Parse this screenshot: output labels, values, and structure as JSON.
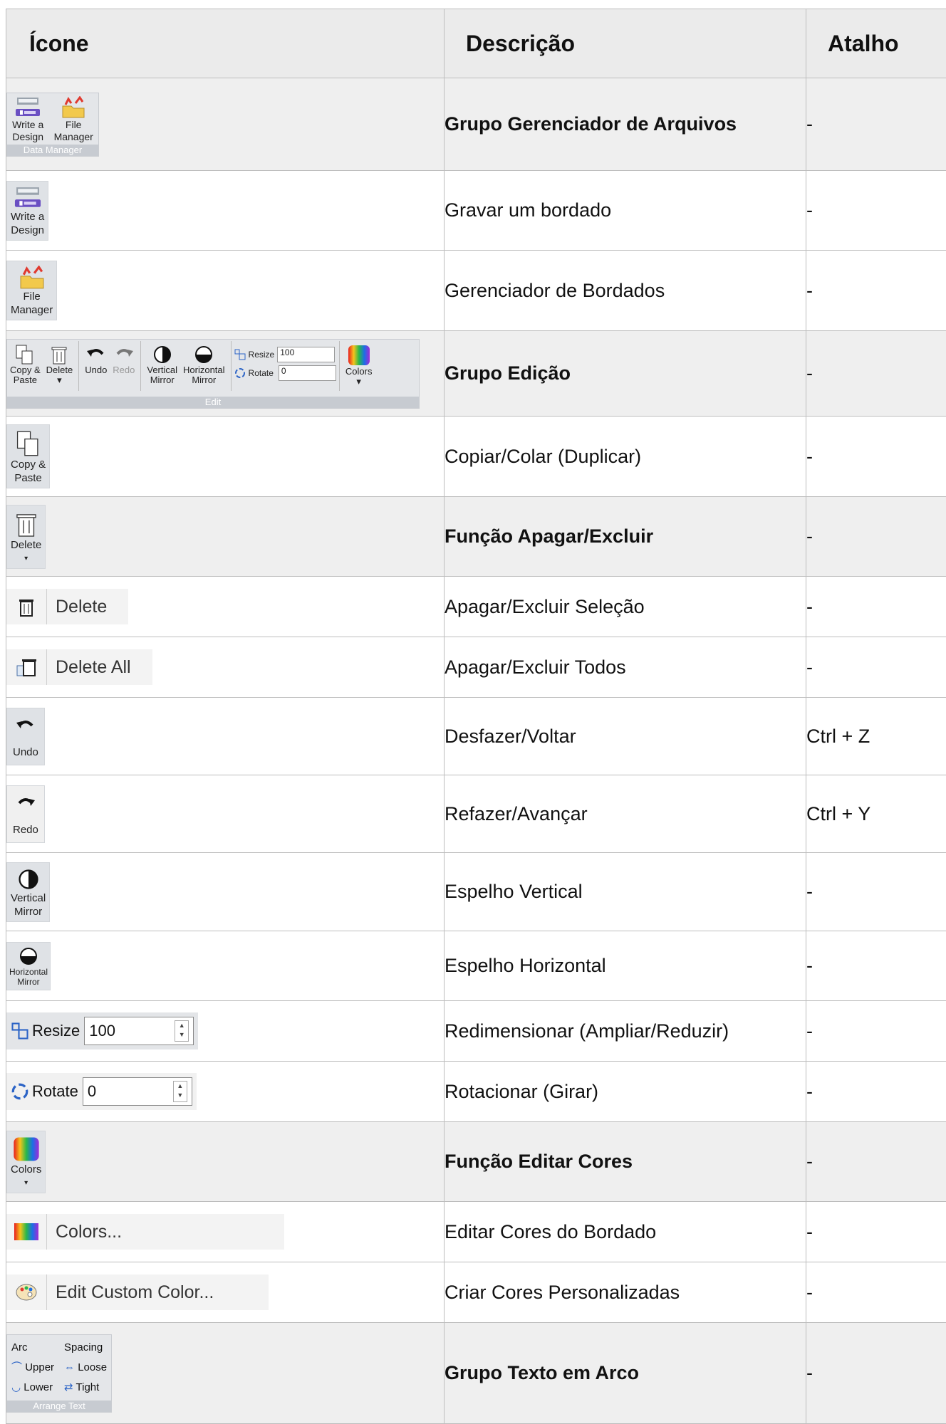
{
  "table": {
    "headers": [
      "Ícone",
      "Descrição",
      "Atalho"
    ],
    "rows": [
      {
        "desc": "Grupo Gerenciador de Arquivos",
        "shortcut": "-"
      },
      {
        "desc": "Gravar um bordado",
        "shortcut": "-"
      },
      {
        "desc": "Gerenciador de Bordados",
        "shortcut": "-"
      },
      {
        "desc": "Grupo Edição",
        "shortcut": "-"
      },
      {
        "desc": "Copiar/Colar (Duplicar)",
        "shortcut": "-"
      },
      {
        "desc": "Função Apagar/Excluir",
        "shortcut": "-"
      },
      {
        "desc": "Apagar/Excluir Seleção",
        "shortcut": "-"
      },
      {
        "desc": "Apagar/Excluir Todos",
        "shortcut": "-"
      },
      {
        "desc": "Desfazer/Voltar",
        "shortcut": "Ctrl + Z"
      },
      {
        "desc": "Refazer/Avançar",
        "shortcut": "Ctrl + Y"
      },
      {
        "desc": "Espelho Vertical",
        "shortcut": "-"
      },
      {
        "desc": "Espelho Horizontal",
        "shortcut": "-"
      },
      {
        "desc": "Redimensionar (Ampliar/Reduzir)",
        "shortcut": "-"
      },
      {
        "desc": "Rotacionar (Girar)",
        "shortcut": "-"
      },
      {
        "desc": "Função Editar Cores",
        "shortcut": "-"
      },
      {
        "desc": "Editar Cores do Bordado",
        "shortcut": "-"
      },
      {
        "desc": "Criar Cores Personalizadas",
        "shortcut": "-"
      },
      {
        "desc": "Grupo Texto em Arco",
        "shortcut": "-"
      }
    ]
  },
  "icons": {
    "write_a_design": [
      "Write a",
      "Design"
    ],
    "file_manager": [
      "File",
      "Manager"
    ],
    "data_manager_caption": "Data Manager",
    "copy_paste": [
      "Copy &",
      "Paste"
    ],
    "delete": "Delete",
    "undo": "Undo",
    "redo": "Redo",
    "vertical_mirror": [
      "Vertical",
      "Mirror"
    ],
    "horizontal_mirror": [
      "Horizontal",
      "Mirror"
    ],
    "resize_label": "Resize",
    "resize_value": "100",
    "rotate_label": "Rotate",
    "rotate_value": "0",
    "colors": "Colors",
    "edit_caption": "Edit",
    "delete_menu": "Delete",
    "delete_all_menu": "Delete All",
    "colors_menu": "Colors...",
    "edit_custom_color_menu": "Edit Custom Color...",
    "arc_label": "Arc",
    "spacing_label": "Spacing",
    "upper": "Upper",
    "lower": "Lower",
    "loose": "Loose",
    "tight": "Tight",
    "arrange_text_caption": "Arrange Text"
  }
}
